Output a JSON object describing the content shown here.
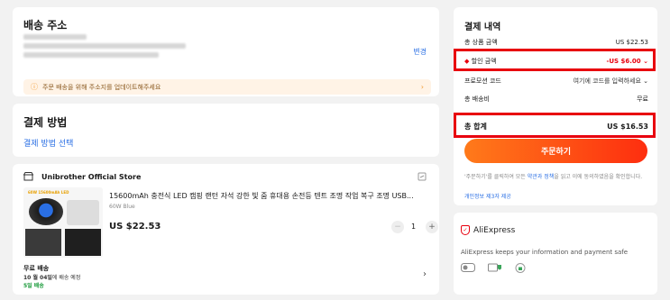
{
  "address": {
    "title": "배송 주소",
    "change_label": "변경",
    "warning": "주문 배송을 위해 주소지를 업데이트해주세요"
  },
  "payment": {
    "title": "결제 방법",
    "select_label": "결제 방법 선택"
  },
  "store": {
    "name": "Unibrother Official Store",
    "product_title": "15600mAh 충전식 LED 캠핑 랜턴 자석 강한 빛 줌 휴대용 손전등 텐트 조명 작업 복구 조명 USB...",
    "variant": "60W Blue",
    "price": "US $22.53",
    "quantity": "1",
    "shipping_label": "무료 배송",
    "delivery_date": "10 월 04일",
    "delivery_suffix": "에 배송 예정",
    "delivery_days": "5일 배송",
    "image_text": "60W 15600mAh LED"
  },
  "summary": {
    "title": "결제 내역",
    "subtotal_label": "총 상품 금액",
    "subtotal_value": "US $22.53",
    "discount_label": "할인 금액",
    "discount_value": "-US $6.00",
    "promo_label": "프로모션 코드",
    "promo_value": "여기에 코드를 입력하세요",
    "shipping_label": "총 배송비",
    "shipping_value": "무료",
    "total_label": "총 합계",
    "total_value": "US $16.53",
    "order_button": "주문하기",
    "terms_prefix": "'주문하기'를 클릭하여 모든 ",
    "terms_link": "약관과 정책",
    "terms_suffix": "을 읽고 이에 동의하였음을 확인합니다.",
    "privacy_link": "개인정보 제3자 제공"
  },
  "trust": {
    "brand": "AliExpress",
    "message": "AliExpress keeps your information and payment safe"
  },
  "colors": {
    "accent_red": "#e8000e",
    "link_blue": "#2a6fe4",
    "button_orange": "#ff7a1a"
  }
}
